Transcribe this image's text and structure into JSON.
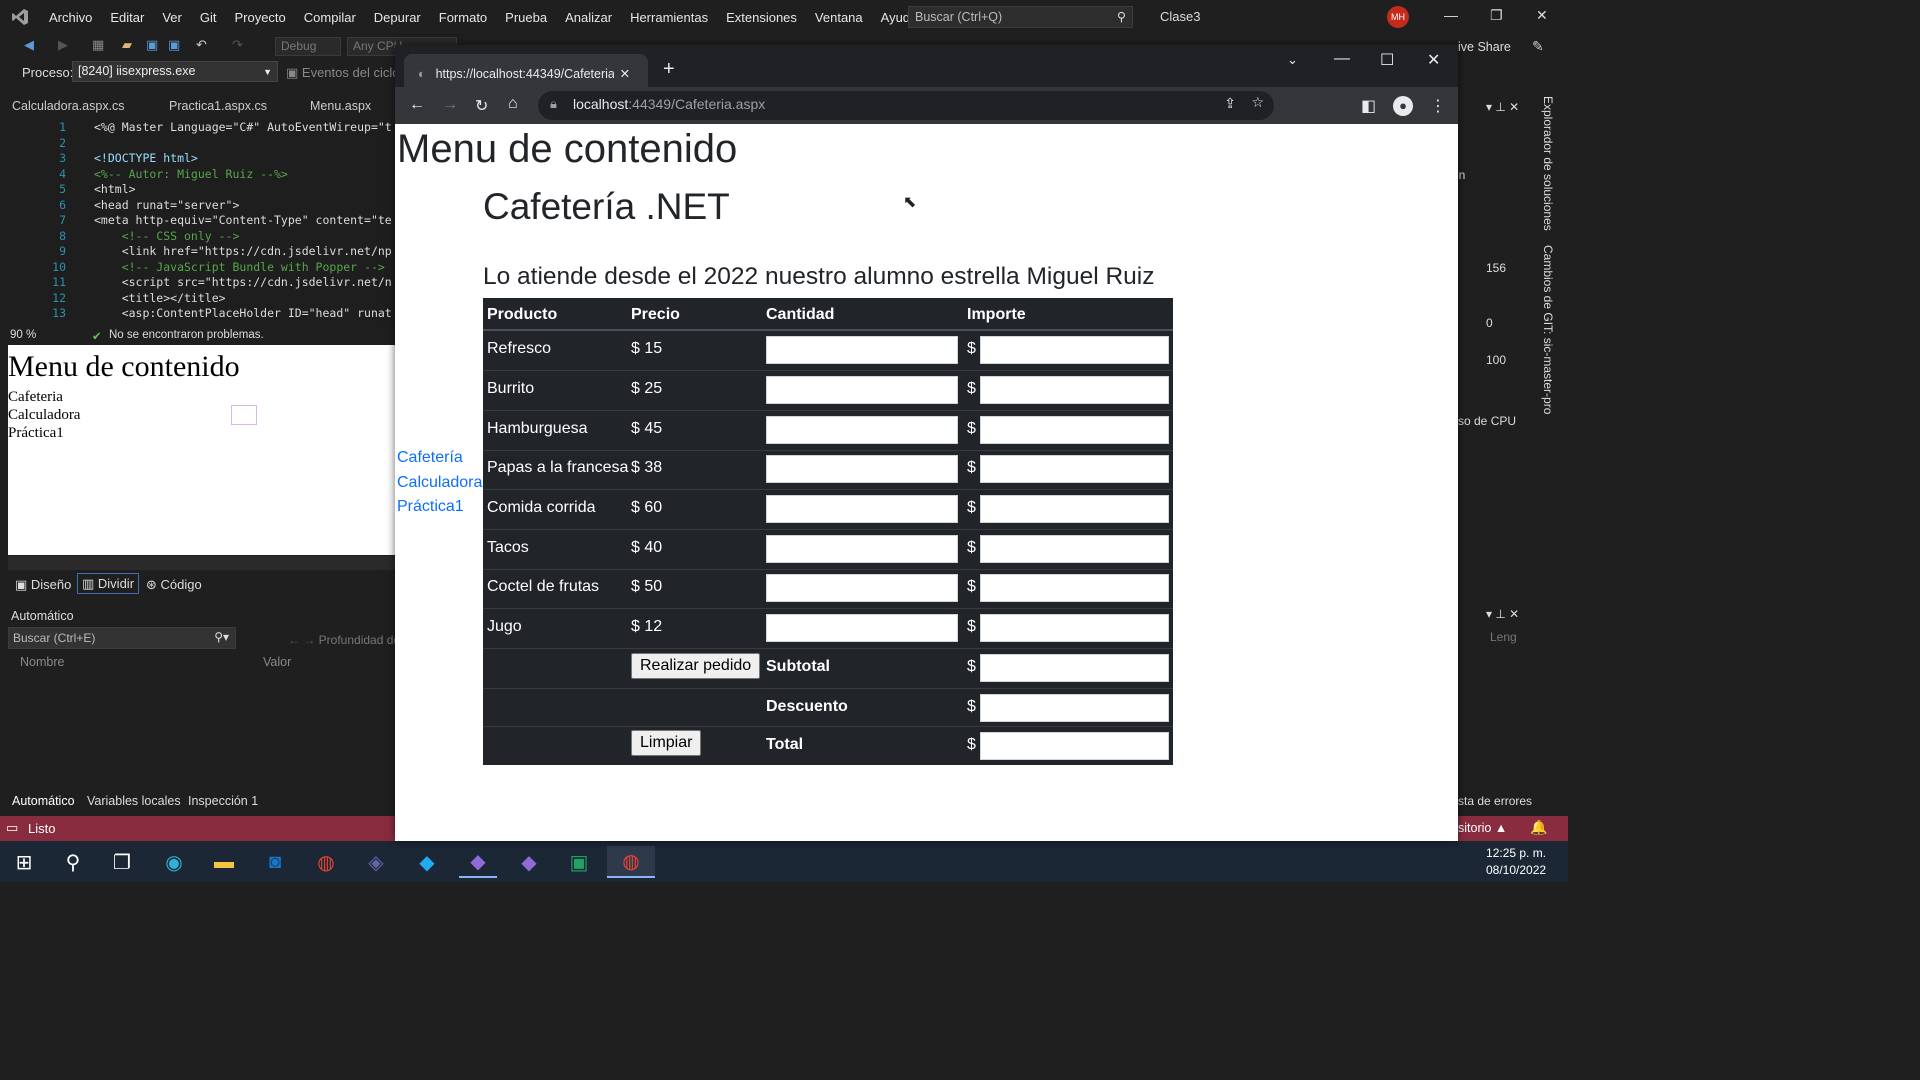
{
  "vs": {
    "menu": [
      "Archivo",
      "Editar",
      "Ver",
      "Git",
      "Proyecto",
      "Compilar",
      "Depurar",
      "Formato",
      "Prueba",
      "Analizar",
      "Herramientas",
      "Extensiones",
      "Ventana",
      "Ayuda"
    ],
    "search_placeholder": "Buscar (Ctrl+Q)",
    "solution": "Clase3",
    "user_initials": "MH",
    "live_share": "ive Share",
    "debug_config": "Debug",
    "platform": "Any CPU",
    "process_label": "Proceso:",
    "process_value": "[8240] iisexpress.exe",
    "events_label": "Eventos del ciclo",
    "doc_tabs": [
      "Calculadora.aspx.cs",
      "Practica1.aspx.cs",
      "Menu.aspx"
    ],
    "code_lines": [
      {
        "n": "1",
        "t": "<%@ Master Language=\"C#\" AutoEventWireup=\"t"
      },
      {
        "n": "2",
        "t": ""
      },
      {
        "n": "3",
        "t": "<!DOCTYPE html>"
      },
      {
        "n": "4",
        "t": "<%-- Autor: Miguel Ruiz --%>"
      },
      {
        "n": "5",
        "t": "<html>"
      },
      {
        "n": "6",
        "t": "<head runat=\"server\">"
      },
      {
        "n": "7",
        "t": "<meta http-equiv=\"Content-Type\" content=\"te"
      },
      {
        "n": "8",
        "t": "    <!-- CSS only -->"
      },
      {
        "n": "9",
        "t": "    <link href=\"https://cdn.jsdelivr.net/np"
      },
      {
        "n": "10",
        "t": "    <!-- JavaScript Bundle with Popper -->"
      },
      {
        "n": "11",
        "t": "    <script src=\"https://cdn.jsdelivr.net/n"
      },
      {
        "n": "12",
        "t": "    <title></title>"
      },
      {
        "n": "13",
        "t": "    <asp:ContentPlaceHolder ID=\"head\" runat"
      }
    ],
    "zoom": "90 %",
    "issues": "No se encontraron problemas.",
    "design_title": "Menu de contenido",
    "design_links": [
      "Cafeteria",
      "Calculadora",
      "Práctica1"
    ],
    "view_tabs": [
      "Diseño",
      "Dividir",
      "Código"
    ],
    "auto_title": "Automático",
    "auto_search": "Buscar (Ctrl+E)",
    "auto_depth": "Profundidad de bús",
    "auto_cols": [
      "Nombre",
      "Valor"
    ],
    "bottom_tabs": [
      "Automático",
      "Variables locales",
      "Inspección 1"
    ],
    "status": "Listo",
    "right": {
      "explorer": "Explorador de soluciones",
      "git": "Cambios de GIT: sic-master-pro",
      "v156": "156",
      "v0": "0",
      "v100": "100",
      "cpu": "so de CPU",
      "errors": "sta de errores",
      "repo": "sitorio",
      "len": "Leng",
      "min": "in"
    },
    "clock_time": "12:25 p. m.",
    "clock_date": "08/10/2022"
  },
  "browser": {
    "tab_title": "https://localhost:44349/Cafeteria",
    "url_host": "localhost",
    "url_rest": ":44349/Cafeteria.aspx"
  },
  "page": {
    "menu_title": "Menu de contenido",
    "title": "Cafetería .NET",
    "subtitle": "Lo atiende desde el 2022 nuestro alumno estrella Miguel Ruiz",
    "nav": [
      "Cafetería",
      "Calculadora",
      "Práctica1"
    ],
    "headers": {
      "product": "Producto",
      "price": "Precio",
      "qty": "Cantidad",
      "amount": "Importe"
    },
    "items": [
      {
        "name": "Refresco",
        "price": "$ 15"
      },
      {
        "name": "Burrito",
        "price": "$ 25"
      },
      {
        "name": "Hamburguesa",
        "price": "$ 45"
      },
      {
        "name": "Papas a la francesa",
        "price": "$ 38"
      },
      {
        "name": "Comida corrida",
        "price": "$ 60"
      },
      {
        "name": "Tacos",
        "price": "$ 40"
      },
      {
        "name": "Coctel de frutas",
        "price": "$ 50"
      },
      {
        "name": "Jugo",
        "price": "$ 12"
      }
    ],
    "currency": "$",
    "order_button": "Realizar pedido",
    "clear_button": "Limpiar",
    "subtotal": "Subtotal",
    "discount": "Descuento",
    "total": "Total"
  }
}
